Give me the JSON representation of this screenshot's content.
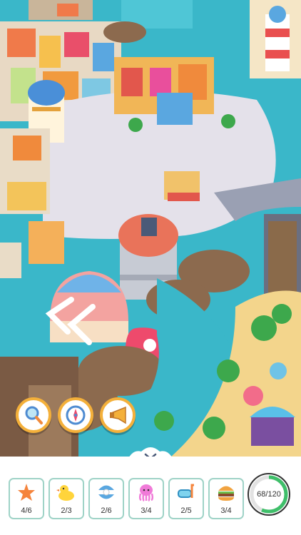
{
  "tools": [
    {
      "name": "magnifier-icon"
    },
    {
      "name": "compass-icon"
    },
    {
      "name": "horn-icon"
    }
  ],
  "items": [
    {
      "icon": "starfish-icon",
      "count": "4/6"
    },
    {
      "icon": "duck-icon",
      "count": "2/3"
    },
    {
      "icon": "pearl-shell-icon",
      "count": "2/6"
    },
    {
      "icon": "octopus-icon",
      "count": "3/4"
    },
    {
      "icon": "snorkel-mask-icon",
      "count": "2/5"
    },
    {
      "icon": "burger-icon",
      "count": "3/4"
    }
  ],
  "progress": {
    "label": "68/120",
    "found": 68,
    "total": 120,
    "ring_color": "#3fbf6a",
    "track_color": "#e2e2e2"
  },
  "colors": {
    "water": "#3ab7c9",
    "button_border": "#f4b03a",
    "card_border": "#9fd3c7"
  }
}
